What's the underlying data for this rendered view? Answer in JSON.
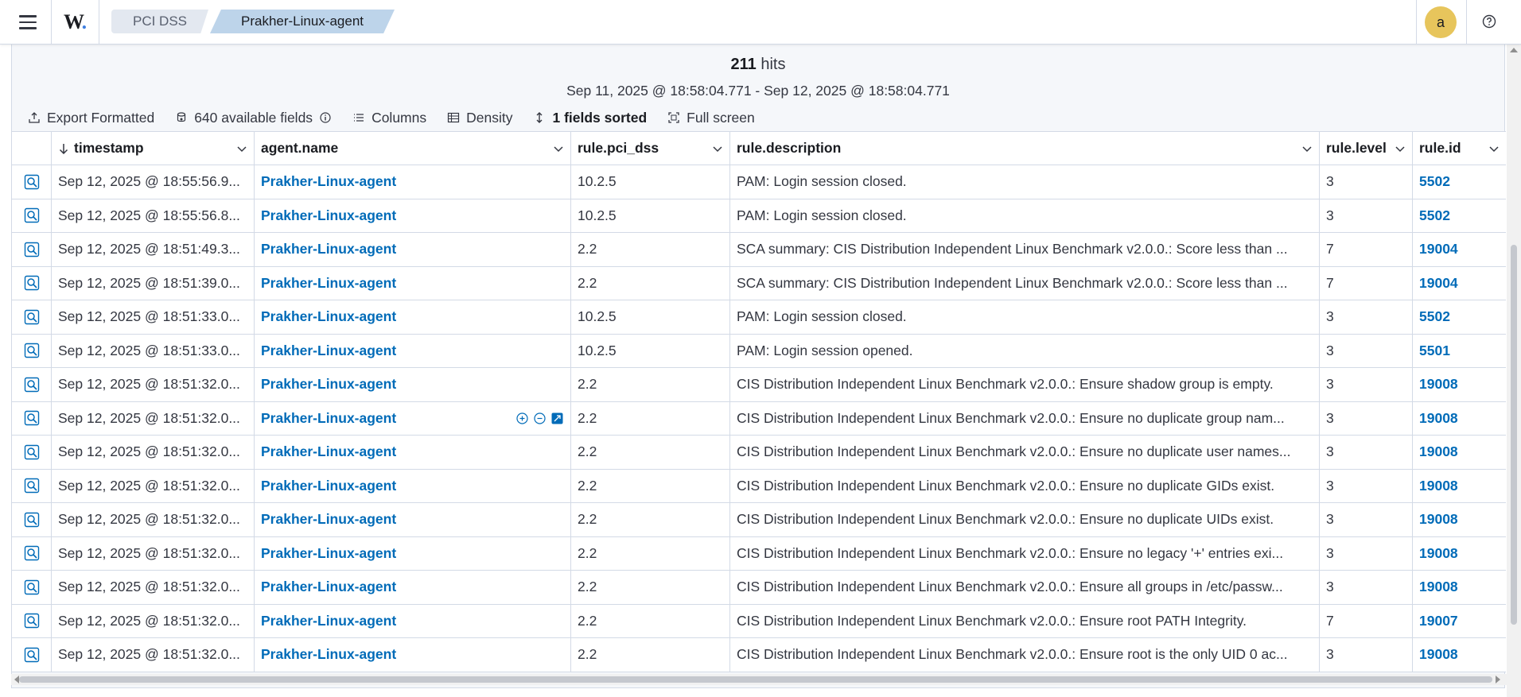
{
  "header": {
    "logo": "W",
    "logo_dot": ".",
    "breadcrumbs": [
      "PCI DSS",
      "Prakher-Linux-agent"
    ],
    "avatar_letter": "a"
  },
  "summary": {
    "hits_count": "211",
    "hits_label": "hits",
    "date_range": "Sep 11, 2025 @ 18:58:04.771 - Sep 12, 2025 @ 18:58:04.771"
  },
  "toolbar": {
    "export": "Export Formatted",
    "fields": "640 available fields",
    "columns": "Columns",
    "density": "Density",
    "sorted": "1 fields sorted",
    "fullscreen": "Full screen"
  },
  "table": {
    "columns": [
      "timestamp",
      "agent.name",
      "rule.pci_dss",
      "rule.description",
      "rule.level",
      "rule.id"
    ],
    "rows": [
      {
        "timestamp": "Sep 12, 2025 @ 18:55:56.9...",
        "agent": "Prakher-Linux-agent",
        "pci": "10.2.5",
        "desc": "PAM: Login session closed.",
        "level": "3",
        "id": "5502"
      },
      {
        "timestamp": "Sep 12, 2025 @ 18:55:56.8...",
        "agent": "Prakher-Linux-agent",
        "pci": "10.2.5",
        "desc": "PAM: Login session closed.",
        "level": "3",
        "id": "5502"
      },
      {
        "timestamp": "Sep 12, 2025 @ 18:51:49.3...",
        "agent": "Prakher-Linux-agent",
        "pci": "2.2",
        "desc": "SCA summary: CIS Distribution Independent Linux Benchmark v2.0.0.: Score less than ...",
        "level": "7",
        "id": "19004"
      },
      {
        "timestamp": "Sep 12, 2025 @ 18:51:39.0...",
        "agent": "Prakher-Linux-agent",
        "pci": "2.2",
        "desc": "SCA summary: CIS Distribution Independent Linux Benchmark v2.0.0.: Score less than ...",
        "level": "7",
        "id": "19004"
      },
      {
        "timestamp": "Sep 12, 2025 @ 18:51:33.0...",
        "agent": "Prakher-Linux-agent",
        "pci": "10.2.5",
        "desc": "PAM: Login session closed.",
        "level": "3",
        "id": "5502"
      },
      {
        "timestamp": "Sep 12, 2025 @ 18:51:33.0...",
        "agent": "Prakher-Linux-agent",
        "pci": "10.2.5",
        "desc": "PAM: Login session opened.",
        "level": "3",
        "id": "5501"
      },
      {
        "timestamp": "Sep 12, 2025 @ 18:51:32.0...",
        "agent": "Prakher-Linux-agent",
        "pci": "2.2",
        "desc": "CIS Distribution Independent Linux Benchmark v2.0.0.: Ensure shadow group is empty.",
        "level": "3",
        "id": "19008"
      },
      {
        "timestamp": "Sep 12, 2025 @ 18:51:32.0...",
        "agent": "Prakher-Linux-agent",
        "pci": "2.2",
        "desc": "CIS Distribution Independent Linux Benchmark v2.0.0.: Ensure no duplicate group nam...",
        "level": "3",
        "id": "19008"
      },
      {
        "timestamp": "Sep 12, 2025 @ 18:51:32.0...",
        "agent": "Prakher-Linux-agent",
        "pci": "2.2",
        "desc": "CIS Distribution Independent Linux Benchmark v2.0.0.: Ensure no duplicate user names...",
        "level": "3",
        "id": "19008"
      },
      {
        "timestamp": "Sep 12, 2025 @ 18:51:32.0...",
        "agent": "Prakher-Linux-agent",
        "pci": "2.2",
        "desc": "CIS Distribution Independent Linux Benchmark v2.0.0.: Ensure no duplicate GIDs exist.",
        "level": "3",
        "id": "19008"
      },
      {
        "timestamp": "Sep 12, 2025 @ 18:51:32.0...",
        "agent": "Prakher-Linux-agent",
        "pci": "2.2",
        "desc": "CIS Distribution Independent Linux Benchmark v2.0.0.: Ensure no duplicate UIDs exist.",
        "level": "3",
        "id": "19008"
      },
      {
        "timestamp": "Sep 12, 2025 @ 18:51:32.0...",
        "agent": "Prakher-Linux-agent",
        "pci": "2.2",
        "desc": "CIS Distribution Independent Linux Benchmark v2.0.0.: Ensure no legacy '+' entries exi...",
        "level": "3",
        "id": "19008"
      },
      {
        "timestamp": "Sep 12, 2025 @ 18:51:32.0...",
        "agent": "Prakher-Linux-agent",
        "pci": "2.2",
        "desc": "CIS Distribution Independent Linux Benchmark v2.0.0.: Ensure all groups in /etc/passw...",
        "level": "3",
        "id": "19008"
      },
      {
        "timestamp": "Sep 12, 2025 @ 18:51:32.0...",
        "agent": "Prakher-Linux-agent",
        "pci": "2.2",
        "desc": "CIS Distribution Independent Linux Benchmark v2.0.0.: Ensure root PATH Integrity.",
        "level": "7",
        "id": "19007"
      },
      {
        "timestamp": "Sep 12, 2025 @ 18:51:32.0...",
        "agent": "Prakher-Linux-agent",
        "pci": "2.2",
        "desc": "CIS Distribution Independent Linux Benchmark v2.0.0.: Ensure root is the only UID 0 ac...",
        "level": "3",
        "id": "19008"
      }
    ]
  },
  "colors": {
    "link": "#006bb8",
    "avatar": "#e7c55c",
    "breadcrumb_active": "#bdd4ea"
  }
}
